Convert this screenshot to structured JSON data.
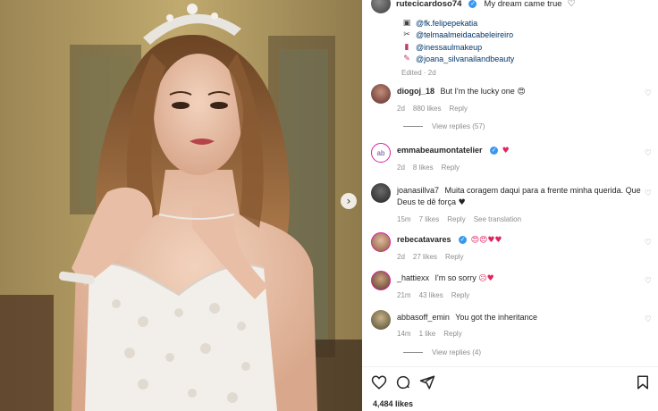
{
  "post": {
    "caption": {
      "username": "rutecicardoso74",
      "text": "My dream came true",
      "heart_icon": "heart-outline-icon",
      "credits": [
        {
          "icon": "camera-icon",
          "handle": "@fk.felipepekatia"
        },
        {
          "icon": "scissors-icon",
          "handle": "@telmaalmeidacabeleireiro"
        },
        {
          "icon": "lipstick-icon",
          "handle": "@inessaulmakeup"
        },
        {
          "icon": "nail-polish-icon",
          "handle": "@joana_silvanailandbeauty"
        }
      ],
      "edited": "Edited · 2d"
    },
    "comments": [
      {
        "user": "diogoj_18",
        "text": "But I'm the lucky one",
        "emoji": "😍",
        "time": "2d",
        "likes": "880 likes",
        "reply": "Reply",
        "view_replies": "View replies (57)"
      },
      {
        "user": "emmabeaumontatelier",
        "verified": true,
        "text": "",
        "emoji": "♥",
        "time": "2d",
        "likes": "8 likes",
        "reply": "Reply"
      },
      {
        "user": "joanasillva7",
        "text": "Muita coragem daqui para a frente minha querida. Que Deus te dê força",
        "emoji": "♥",
        "time": "15m",
        "likes": "7 likes",
        "reply": "Reply",
        "translation": "See translation"
      },
      {
        "user": "rebecatavares",
        "verified": true,
        "text": "",
        "emoji": "😍😍♥♥",
        "time": "2d",
        "likes": "27 likes",
        "reply": "Reply"
      },
      {
        "user": "_hattiexx",
        "text": "I'm so sorry",
        "emoji": "☹♥",
        "time": "21m",
        "likes": "43 likes",
        "reply": "Reply"
      },
      {
        "user": "abbasoff_emin",
        "text": "You got the inheritance",
        "emoji": "",
        "time": "14m",
        "likes": "1 like",
        "reply": "Reply",
        "view_replies": "View replies (4)"
      }
    ],
    "likes": "4,484 likes",
    "carousel_icon": "chevron-right-icon",
    "action_icons": [
      "heart-outline-icon",
      "comment-icon",
      "share-icon",
      "bookmark-icon"
    ]
  },
  "colors": {
    "link": "#00376b",
    "meta": "#8e8e8e",
    "verified": "#3897f0",
    "heart_red": "#e0245e"
  }
}
